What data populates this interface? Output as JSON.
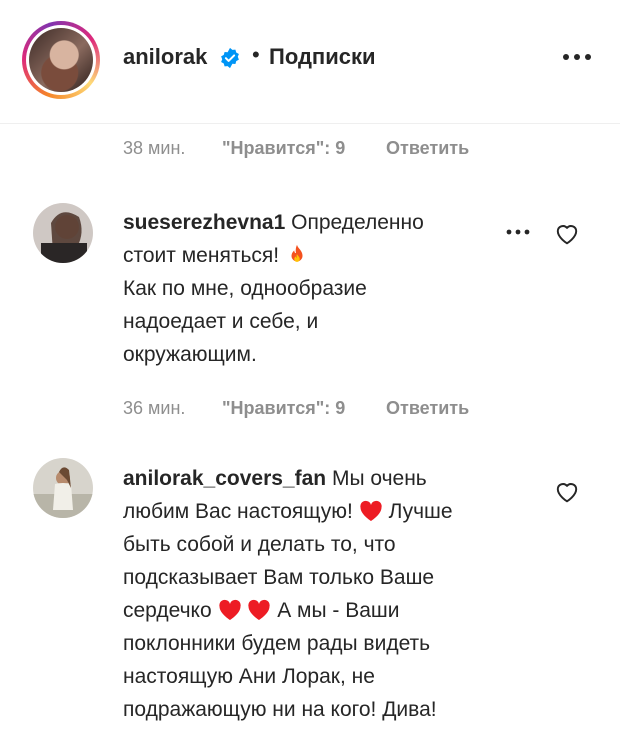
{
  "header": {
    "username": "anilorak",
    "separator": "•",
    "follow_label": "Подписки",
    "verified_icon": "verified-badge-icon",
    "more_icon": "more-horizontal-icon"
  },
  "comments": [
    {
      "meta": {
        "time": "38 мин.",
        "likes": "\"Нравится\": 9",
        "reply": "Ответить"
      }
    },
    {
      "author": "sueserezhevna1",
      "lines": [
        "Определенно",
        "стоит меняться!",
        "Как по мне, однообразие",
        "надоедает и себе, и",
        "окружающим."
      ],
      "emoji": "fire-icon",
      "meta": {
        "time": "36 мин.",
        "likes": "\"Нравится\": 9",
        "reply": "Ответить"
      }
    },
    {
      "author": "anilorak_covers_fan",
      "lines": [
        "Мы очень",
        "любим Вас настоящую!",
        "Лучше",
        "быть собой и делать то, что",
        "подсказывает Вам только Ваше",
        "сердечко",
        "А мы - Ваши",
        "поклонники будем рады видеть",
        "настоящую Ани Лорак, не",
        "подражающую ни на кого! Дива!"
      ],
      "emoji": "red-heart-icon"
    }
  ],
  "colors": {
    "text": "#262626",
    "muted": "#8e8e8e",
    "verified": "#0095f6",
    "heart_red": "#ed1c24"
  }
}
